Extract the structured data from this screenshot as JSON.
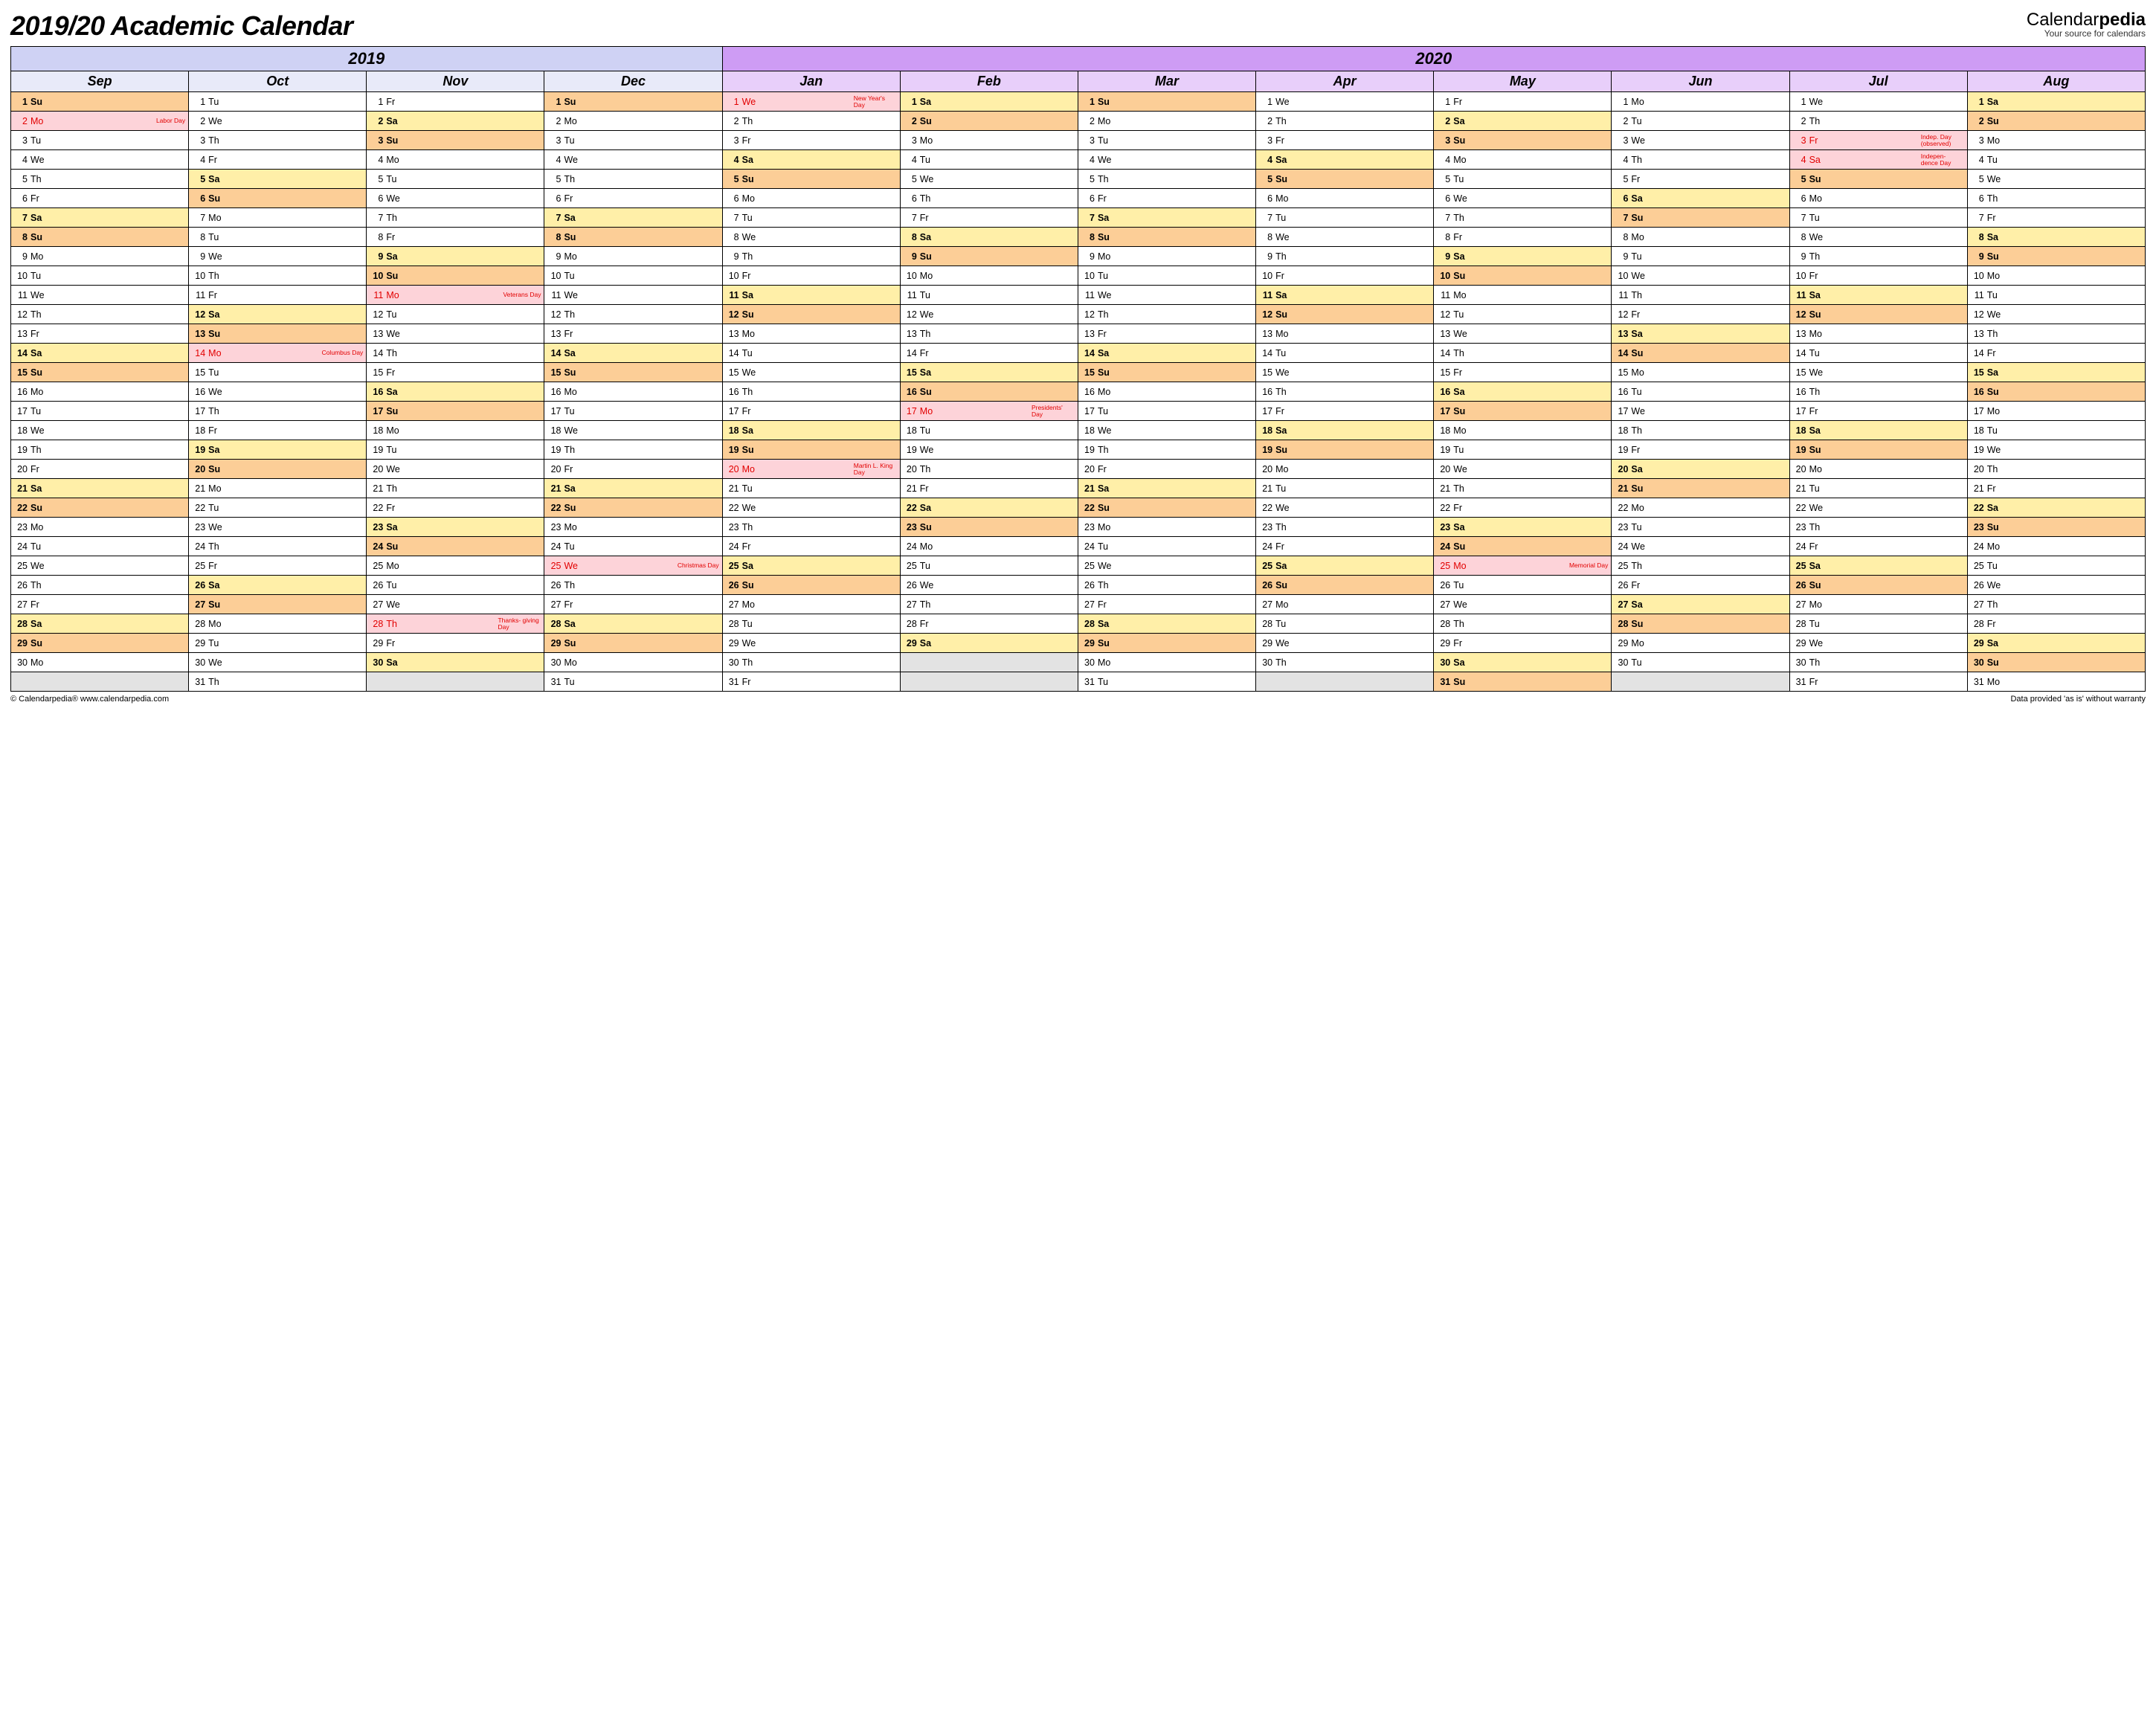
{
  "title": "2019/20 Academic Calendar",
  "brand": {
    "a": "Calendar",
    "b": "pedia",
    "sub": "Your source for calendars"
  },
  "footer": {
    "left": "© Calendarpedia®   www.calendarpedia.com",
    "right": "Data provided 'as is' without warranty"
  },
  "years": [
    {
      "label": "2019",
      "cls": "y2019",
      "span": 4
    },
    {
      "label": "2020",
      "cls": "y2020",
      "span": 8
    }
  ],
  "months": [
    {
      "label": "Sep",
      "cls": "m2019"
    },
    {
      "label": "Oct",
      "cls": "m2019"
    },
    {
      "label": "Nov",
      "cls": "m2019"
    },
    {
      "label": "Dec",
      "cls": "m2019"
    },
    {
      "label": "Jan",
      "cls": "m2020"
    },
    {
      "label": "Feb",
      "cls": "m2020"
    },
    {
      "label": "Mar",
      "cls": "m2020"
    },
    {
      "label": "Apr",
      "cls": "m2020"
    },
    {
      "label": "May",
      "cls": "m2020"
    },
    {
      "label": "Jun",
      "cls": "m2020"
    },
    {
      "label": "Jul",
      "cls": "m2020"
    },
    {
      "label": "Aug",
      "cls": "m2020"
    }
  ],
  "startDow": [
    0,
    2,
    5,
    0,
    3,
    6,
    0,
    3,
    5,
    1,
    3,
    6
  ],
  "lengths": [
    30,
    31,
    30,
    31,
    31,
    29,
    31,
    30,
    31,
    30,
    31,
    31
  ],
  "dowNames": [
    "Su",
    "Mo",
    "Tu",
    "We",
    "Th",
    "Fr",
    "Sa"
  ],
  "holidays": {
    "0-2": {
      "t": "Labor Day"
    },
    "1-14": {
      "t": "Columbus Day"
    },
    "2-11": {
      "t": "Veterans Day"
    },
    "2-28": {
      "t": "Thanks- giving Day"
    },
    "3-25": {
      "t": "Christmas Day"
    },
    "4-1": {
      "t": "New Year's Day"
    },
    "4-20": {
      "t": "Martin L. King Day"
    },
    "5-17": {
      "t": "Presidents' Day"
    },
    "8-25": {
      "t": "Memorial Day"
    },
    "10-3": {
      "t": "Indep. Day (observed)"
    },
    "10-4": {
      "t": "Indepen- dence Day"
    }
  }
}
